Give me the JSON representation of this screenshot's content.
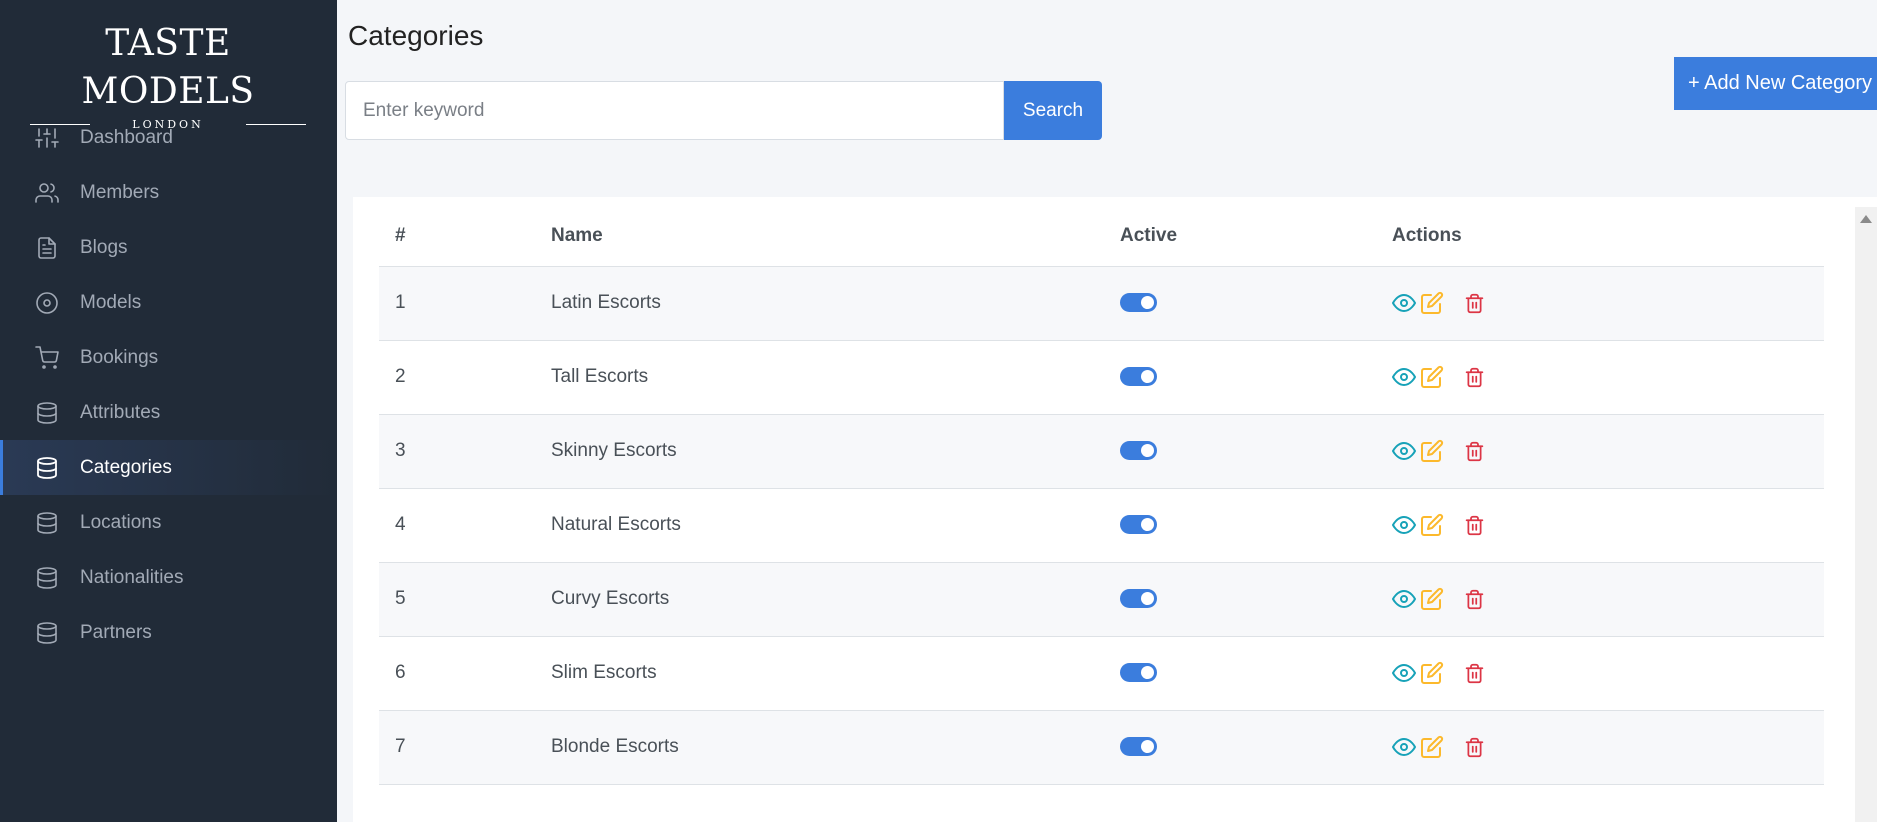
{
  "brand": {
    "title": "TASTE MODELS",
    "subtitle": "LONDON"
  },
  "sidebar": {
    "items": [
      {
        "label": "Dashboard",
        "icon": "sliders-icon"
      },
      {
        "label": "Members",
        "icon": "users-icon"
      },
      {
        "label": "Blogs",
        "icon": "document-icon"
      },
      {
        "label": "Models",
        "icon": "disc-icon"
      },
      {
        "label": "Bookings",
        "icon": "cart-icon"
      },
      {
        "label": "Attributes",
        "icon": "database-icon"
      },
      {
        "label": "Categories",
        "icon": "database-icon",
        "active": true
      },
      {
        "label": "Locations",
        "icon": "database-icon"
      },
      {
        "label": "Nationalities",
        "icon": "database-icon"
      },
      {
        "label": "Partners",
        "icon": "database-icon"
      }
    ]
  },
  "page": {
    "title": "Categories"
  },
  "search": {
    "placeholder": "Enter keyword",
    "value": "",
    "button_label": "Search"
  },
  "add_button_label": "+ Add New Category",
  "table": {
    "headers": {
      "num": "#",
      "name": "Name",
      "active": "Active",
      "actions": "Actions"
    },
    "rows": [
      {
        "num": "1",
        "name": "Latin Escorts",
        "active": true
      },
      {
        "num": "2",
        "name": "Tall Escorts",
        "active": true
      },
      {
        "num": "3",
        "name": "Skinny Escorts",
        "active": true
      },
      {
        "num": "4",
        "name": "Natural Escorts",
        "active": true
      },
      {
        "num": "5",
        "name": "Curvy Escorts",
        "active": true
      },
      {
        "num": "6",
        "name": "Slim Escorts",
        "active": true
      },
      {
        "num": "7",
        "name": "Blonde Escorts",
        "active": true
      }
    ]
  },
  "colors": {
    "accent": "#3b7ddd",
    "sidebar_bg": "#212b38",
    "view_icon": "#17a2b8",
    "edit_icon": "#fcb92c",
    "delete_icon": "#dc3545"
  }
}
